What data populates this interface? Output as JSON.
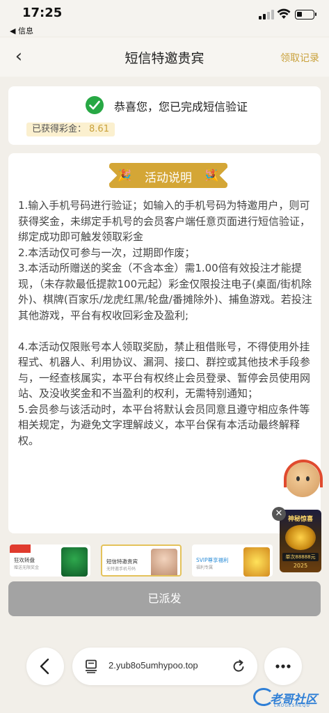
{
  "status_bar": {
    "time": "17:25",
    "back_app": "◀ 信息"
  },
  "header": {
    "title": "短信特邀贵宾",
    "right_link": "领取记录"
  },
  "success": {
    "message": "恭喜您，您已完成短信验证",
    "bonus_label": "已获得彩金：",
    "bonus_amount": "8.61"
  },
  "activity": {
    "badge": "活动说明",
    "rules": [
      "1.输入手机号码进行验证；如输入的手机号码为特邀用户，则可获得奖金，未绑定手机号的会员客户端任意页面进行短信验证，绑定成功即可触发领取彩金",
      "2.本活动仅可参与一次，过期即作废；",
      "3.本活动所赠送的奖金（不含本金）需1.00倍有效投注才能提现，（未存款最低提款100元起）彩金仅限投注电子(桌面/街机除外)、棋牌(百家乐/龙虎红黑/轮盘/番摊除外)、捕鱼游戏。若投注其他游戏，平台有权收回彩金及盈利;",
      "",
      "4.本活动仅限账号本人领取奖励，禁止租借账号，不得使用外挂程式、机器人、利用协议、漏洞、接口、群控或其他技术手段参与，一经查核属实，本平台有权终止会员登录、暂停会员使用网站、及没收奖金和不当盈利的权利，无需特别通知；",
      "5.会员参与该活动时，本平台将默认会员同意且遵守相应条件等相关规定，为避免文字理解歧义，本平台保有本活动最终解释权。"
    ]
  },
  "floating": {
    "promo_title": "神秘惊喜",
    "promo_amount": "单次88888元",
    "promo_year": "2025"
  },
  "banners": [
    {
      "label": "狂欢转盘",
      "sub": "赠送无限奖金"
    },
    {
      "label": "短信特邀贵宾",
      "sub": "无特邀手机号码"
    },
    {
      "label": "SVIP尊享福利",
      "sub": "福利专属"
    }
  ],
  "dispatched_button": "已派发",
  "browser": {
    "url": "2.yub8o5umhypoo.top"
  },
  "watermark": {
    "text": "老哥社区",
    "sub": "LAOGESHEQU"
  },
  "colors": {
    "accent_gold": "#d4a636",
    "success_green": "#27a844",
    "disabled_gray": "#a3a3a3"
  }
}
